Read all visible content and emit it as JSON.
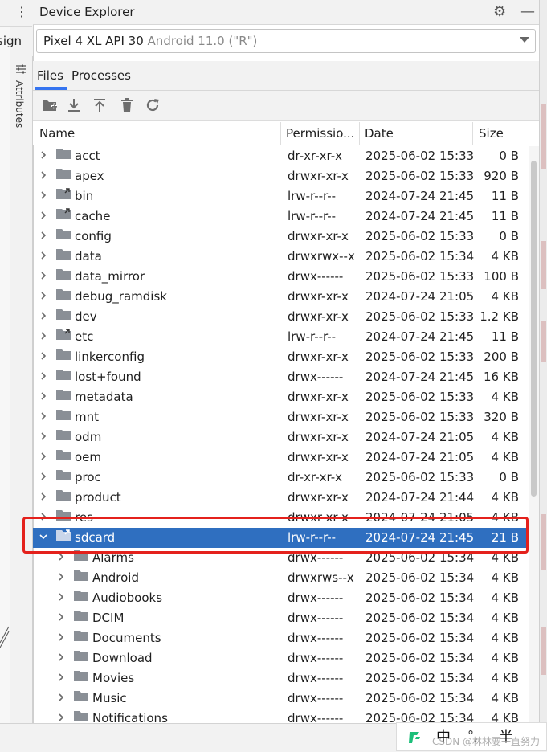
{
  "left_editor": {
    "tab_label": "sign",
    "attributes_label": "Attributes"
  },
  "panel": {
    "title": "Device Explorer",
    "device": {
      "name": "Pixel 4 XL API 30",
      "subtitle": "Android 11.0 (\"R\")"
    },
    "tabs": [
      {
        "label": "Files"
      },
      {
        "label": "Processes"
      }
    ],
    "columns": {
      "name": "Name",
      "permissions": "Permissio...",
      "date": "Date",
      "size": "Size"
    },
    "rows": [
      {
        "name": "acct",
        "perm": "dr-xr-xr-x",
        "date": "2025-06-02 15:33",
        "size": "0 B",
        "icon": "folder-icon",
        "level": 0,
        "expanded": false,
        "selected": false
      },
      {
        "name": "apex",
        "perm": "drwxr-xr-x",
        "date": "2025-06-02 15:33",
        "size": "920 B",
        "icon": "folder-icon",
        "level": 0,
        "expanded": false,
        "selected": false
      },
      {
        "name": "bin",
        "perm": "lrw-r--r--",
        "date": "2024-07-24 21:45",
        "size": "11 B",
        "icon": "folder-link-icon",
        "level": 0,
        "expanded": false,
        "selected": false
      },
      {
        "name": "cache",
        "perm": "lrw-r--r--",
        "date": "2024-07-24 21:45",
        "size": "11 B",
        "icon": "folder-link-icon",
        "level": 0,
        "expanded": false,
        "selected": false
      },
      {
        "name": "config",
        "perm": "drwxr-xr-x",
        "date": "2025-06-02 15:33",
        "size": "0 B",
        "icon": "folder-icon",
        "level": 0,
        "expanded": false,
        "selected": false
      },
      {
        "name": "data",
        "perm": "drwxrwx--x",
        "date": "2025-06-02 15:34",
        "size": "4 KB",
        "icon": "folder-icon",
        "level": 0,
        "expanded": false,
        "selected": false
      },
      {
        "name": "data_mirror",
        "perm": "drwx------",
        "date": "2025-06-02 15:33",
        "size": "100 B",
        "icon": "folder-icon",
        "level": 0,
        "expanded": false,
        "selected": false
      },
      {
        "name": "debug_ramdisk",
        "perm": "drwxr-xr-x",
        "date": "2024-07-24 21:05",
        "size": "4 KB",
        "icon": "folder-icon",
        "level": 0,
        "expanded": false,
        "selected": false
      },
      {
        "name": "dev",
        "perm": "drwxr-xr-x",
        "date": "2025-06-02 15:33",
        "size": "1.2 KB",
        "icon": "folder-icon",
        "level": 0,
        "expanded": false,
        "selected": false
      },
      {
        "name": "etc",
        "perm": "lrw-r--r--",
        "date": "2024-07-24 21:45",
        "size": "11 B",
        "icon": "folder-link-icon",
        "level": 0,
        "expanded": false,
        "selected": false
      },
      {
        "name": "linkerconfig",
        "perm": "drwxr-xr-x",
        "date": "2025-06-02 15:33",
        "size": "200 B",
        "icon": "folder-icon",
        "level": 0,
        "expanded": false,
        "selected": false
      },
      {
        "name": "lost+found",
        "perm": "drwx------",
        "date": "2024-07-24 21:45",
        "size": "16 KB",
        "icon": "folder-icon",
        "level": 0,
        "expanded": false,
        "selected": false
      },
      {
        "name": "metadata",
        "perm": "drwxr-xr-x",
        "date": "2025-06-02 15:33",
        "size": "4 KB",
        "icon": "folder-icon",
        "level": 0,
        "expanded": false,
        "selected": false
      },
      {
        "name": "mnt",
        "perm": "drwxr-xr-x",
        "date": "2025-06-02 15:33",
        "size": "320 B",
        "icon": "folder-icon",
        "level": 0,
        "expanded": false,
        "selected": false
      },
      {
        "name": "odm",
        "perm": "drwxr-xr-x",
        "date": "2024-07-24 21:05",
        "size": "4 KB",
        "icon": "folder-icon",
        "level": 0,
        "expanded": false,
        "selected": false
      },
      {
        "name": "oem",
        "perm": "drwxr-xr-x",
        "date": "2024-07-24 21:05",
        "size": "4 KB",
        "icon": "folder-icon",
        "level": 0,
        "expanded": false,
        "selected": false
      },
      {
        "name": "proc",
        "perm": "dr-xr-xr-x",
        "date": "2025-06-02 15:33",
        "size": "0 B",
        "icon": "folder-icon",
        "level": 0,
        "expanded": false,
        "selected": false
      },
      {
        "name": "product",
        "perm": "drwxr-xr-x",
        "date": "2024-07-24 21:44",
        "size": "4 KB",
        "icon": "folder-icon",
        "level": 0,
        "expanded": false,
        "selected": false
      },
      {
        "name": "res",
        "perm": "drwxr-xr-x",
        "date": "2024-07-24 21:05",
        "size": "4 KB",
        "icon": "folder-icon",
        "level": 0,
        "expanded": false,
        "selected": false
      },
      {
        "name": "sdcard",
        "perm": "lrw-r--r--",
        "date": "2024-07-24 21:45",
        "size": "21 B",
        "icon": "folder-link-icon",
        "level": 0,
        "expanded": true,
        "selected": true
      },
      {
        "name": "Alarms",
        "perm": "drwx------",
        "date": "2025-06-02 15:34",
        "size": "4 KB",
        "icon": "folder-icon",
        "level": 1,
        "expanded": false,
        "selected": false
      },
      {
        "name": "Android",
        "perm": "drwxrws--x",
        "date": "2025-06-02 15:34",
        "size": "4 KB",
        "icon": "folder-icon",
        "level": 1,
        "expanded": false,
        "selected": false
      },
      {
        "name": "Audiobooks",
        "perm": "drwx------",
        "date": "2025-06-02 15:34",
        "size": "4 KB",
        "icon": "folder-icon",
        "level": 1,
        "expanded": false,
        "selected": false
      },
      {
        "name": "DCIM",
        "perm": "drwx------",
        "date": "2025-06-02 15:34",
        "size": "4 KB",
        "icon": "folder-icon",
        "level": 1,
        "expanded": false,
        "selected": false
      },
      {
        "name": "Documents",
        "perm": "drwx------",
        "date": "2025-06-02 15:34",
        "size": "4 KB",
        "icon": "folder-icon",
        "level": 1,
        "expanded": false,
        "selected": false
      },
      {
        "name": "Download",
        "perm": "drwx------",
        "date": "2025-06-02 15:34",
        "size": "4 KB",
        "icon": "folder-icon",
        "level": 1,
        "expanded": false,
        "selected": false
      },
      {
        "name": "Movies",
        "perm": "drwx------",
        "date": "2025-06-02 15:34",
        "size": "4 KB",
        "icon": "folder-icon",
        "level": 1,
        "expanded": false,
        "selected": false
      },
      {
        "name": "Music",
        "perm": "drwx------",
        "date": "2025-06-02 15:34",
        "size": "4 KB",
        "icon": "folder-icon",
        "level": 1,
        "expanded": false,
        "selected": false
      },
      {
        "name": "Notifications",
        "perm": "drwx------",
        "date": "2025-06-02 15:34",
        "size": "4 KB",
        "icon": "folder-icon",
        "level": 1,
        "expanded": false,
        "selected": false
      }
    ]
  },
  "ime": {
    "chinese_label": "中",
    "punct_label": "°,",
    "half_width_label": "半"
  },
  "watermark": "CSDN @林林要一直努力",
  "colors": {
    "selection": "#2f6fc0",
    "highlight_box": "#e4211c",
    "accent": "#3574f0",
    "folder": "#8a8f96"
  }
}
